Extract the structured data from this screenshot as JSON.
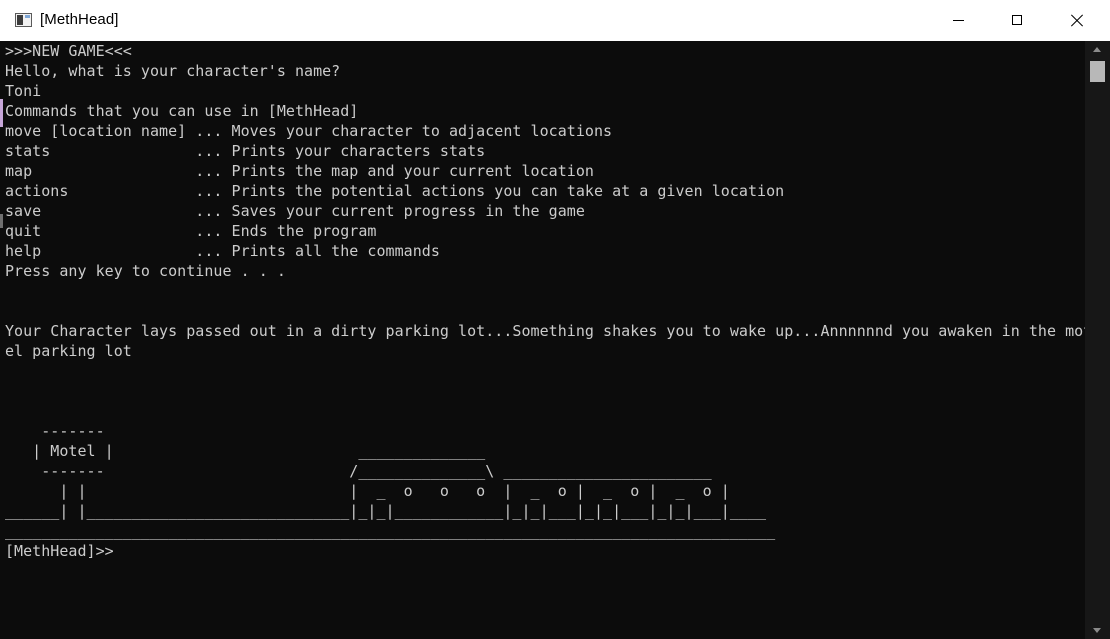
{
  "window": {
    "title": "[MethHead]",
    "icon": "console-app-icon",
    "controls": {
      "minimize": "minimize-icon",
      "maximize": "maximize-icon",
      "close": "close-icon"
    }
  },
  "console": {
    "lines": [
      ">>>NEW GAME<<<",
      "Hello, what is your character's name?",
      "Toni",
      "Commands that you can use in [MethHead]",
      "move [location name] ... Moves your character to adjacent locations",
      "stats                ... Prints your characters stats",
      "map                  ... Prints the map and your current location",
      "actions              ... Prints the potential actions you can take at a given location",
      "save                 ... Saves your current progress in the game",
      "quit                 ... Ends the program",
      "help                 ... Prints all the commands",
      "Press any key to continue . . .",
      "",
      "",
      "Your Character lays passed out in a dirty parking lot...Something shakes you to wake up...Annnnnnd you awaken in the mot",
      "el parking lot",
      "",
      "",
      "",
      "    -------",
      "   | Motel |                           ______________",
      "    -------                           /______________\\ _______________________",
      "      | |                             |  _  o   o   o  |  _  o |  _  o |  _  o |",
      "______| |_____________________________|_|_|____________|_|_|___|_|_|___|_|_|___|____",
      "_____________________________________________________________________________________",
      "[MethHead]>>"
    ]
  },
  "scrollbar": {
    "up_icon": "scroll-up-arrow-icon",
    "down_icon": "scroll-down-arrow-icon"
  },
  "colors": {
    "console_background": "#0c0c0c",
    "console_text": "#cccccc",
    "titlebar_background": "#ffffff"
  }
}
